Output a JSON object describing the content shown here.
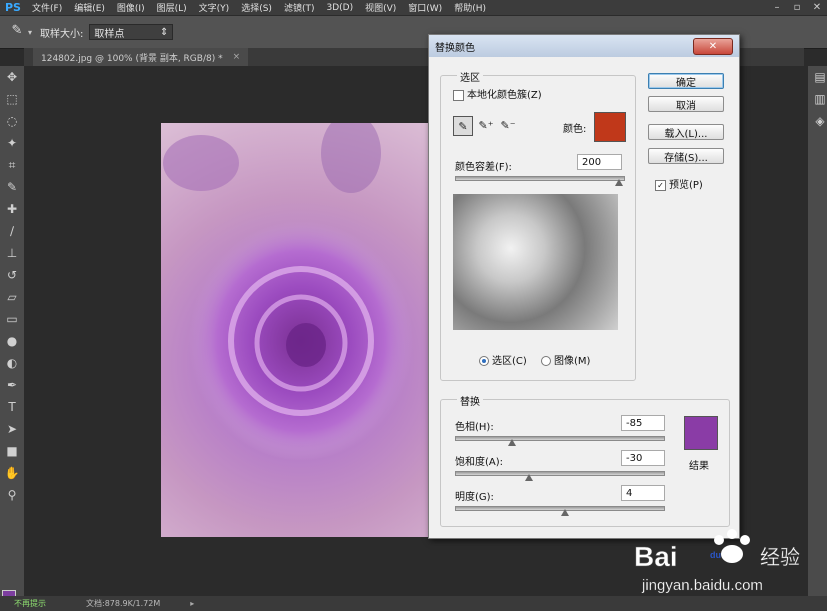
{
  "app": {
    "logo": "PS"
  },
  "menu": [
    "文件(F)",
    "编辑(E)",
    "图像(I)",
    "图层(L)",
    "文字(Y)",
    "选择(S)",
    "滤镜(T)",
    "3D(D)",
    "视图(V)",
    "窗口(W)",
    "帮助(H)"
  ],
  "options_bar": {
    "sample_size_label": "取样大小:",
    "sample_size_value": "取样点"
  },
  "document_tab": {
    "title": "124802.jpg @ 100% (背景 副本, RGB/8) *"
  },
  "status_bar": {
    "left_text": "不再提示",
    "doc_info": "文档:878.9K/1.72M"
  },
  "dialog": {
    "title": "替换颜色",
    "selection": {
      "group_label": "选区",
      "localized_checkbox": "本地化颜色簇(Z)",
      "color_label": "颜色:",
      "color_value": "#c0381a",
      "fuzziness_label": "颜色容差(F):",
      "fuzziness_value": "200",
      "radio_selection": "选区(C)",
      "radio_image": "图像(M)"
    },
    "buttons": {
      "ok": "确定",
      "cancel": "取消",
      "load": "载入(L)...",
      "save": "存储(S)..."
    },
    "preview_checkbox": "预览(P)",
    "replacement": {
      "group_label": "替换",
      "hue_label": "色相(H):",
      "hue_value": "-85",
      "saturation_label": "饱和度(A):",
      "saturation_value": "-30",
      "lightness_label": "明度(G):",
      "lightness_value": "4",
      "result_label": "结果",
      "result_color": "#8a3ca6"
    }
  },
  "watermark": {
    "brand": "Bai",
    "brand_suffix": "du",
    "product": "经验",
    "url": "jingyan.baidu.com"
  }
}
